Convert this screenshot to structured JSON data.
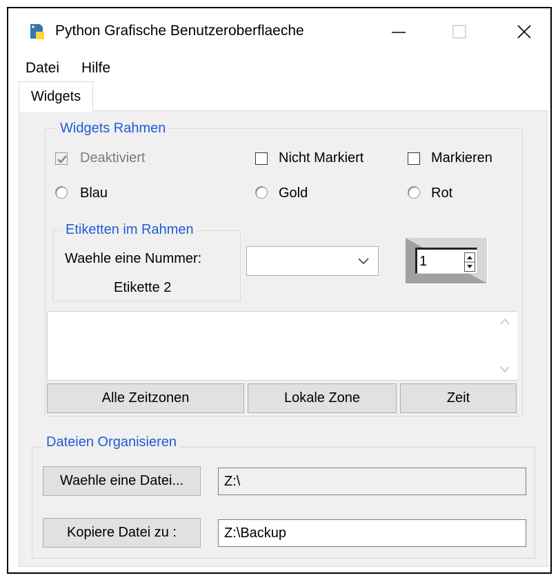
{
  "window": {
    "title": "Python Grafische Benutzeroberflaeche"
  },
  "menu": {
    "items": [
      "Datei",
      "Hilfe"
    ]
  },
  "tabs": [
    "Widgets"
  ],
  "widgets_frame": {
    "legend": "Widgets Rahmen",
    "checkboxes": [
      {
        "label": "Deaktiviert",
        "checked": true,
        "disabled": true
      },
      {
        "label": "Nicht Markiert",
        "checked": false
      },
      {
        "label": "Markieren",
        "checked": false
      }
    ],
    "radios": [
      "Blau",
      "Gold",
      "Rot"
    ],
    "labels_frame": {
      "legend": "Etiketten im Rahmen",
      "label1": "Waehle eine Nummer:",
      "label2": "Etikette 2"
    },
    "combobox": {
      "value": ""
    },
    "spinbox": {
      "value": "1"
    },
    "scrolltext": {
      "value": ""
    },
    "buttons": [
      "Alle Zeitzonen",
      "Lokale Zone",
      "Zeit"
    ]
  },
  "files_frame": {
    "legend": "Dateien Organisieren",
    "choose_button": "Waehle eine Datei...",
    "choose_path": "Z:\\",
    "copy_button": "Kopiere Datei zu :",
    "copy_path": "Z:\\Backup"
  },
  "colors": {
    "legend": "#1e5bd7",
    "panel": "#f0f0f0",
    "button": "#e1e1e1"
  }
}
